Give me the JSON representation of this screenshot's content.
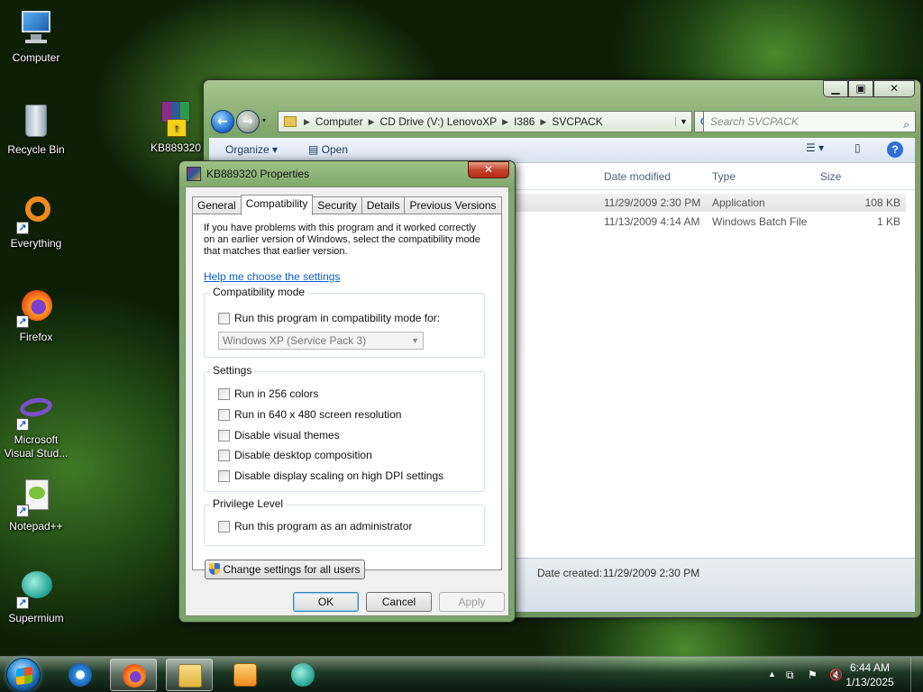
{
  "desktop": {
    "icons": [
      {
        "label": "Computer"
      },
      {
        "label": "Recycle Bin"
      },
      {
        "label": "Everything"
      },
      {
        "label": "Firefox"
      },
      {
        "label": "Microsoft Visual Stud..."
      },
      {
        "label": "Notepad++"
      },
      {
        "label": "Supermium"
      },
      {
        "label": "KB889320"
      }
    ]
  },
  "explorer": {
    "address": [
      "Computer",
      "CD Drive (V:) LenovoXP",
      "I386",
      "SVCPACK"
    ],
    "search_placeholder": "Search SVCPACK",
    "organize_label": "Organize",
    "open_label": "Open",
    "columns": [
      "Date modified",
      "Type",
      "Size"
    ],
    "files": [
      {
        "date": "11/29/2009 2:30 PM",
        "type": "Application",
        "size": "108 KB"
      },
      {
        "date": "11/13/2009 4:14 AM",
        "type": "Windows Batch File",
        "size": "1 KB"
      }
    ],
    "details_label": "Date created:",
    "details_value": "11/29/2009 2:30 PM"
  },
  "dialog": {
    "title": "KB889320 Properties",
    "tabs": [
      "General",
      "Compatibility",
      "Security",
      "Details",
      "Previous Versions"
    ],
    "intro": "If you have problems with this program and it worked correctly on an earlier version of Windows, select the compatibility mode that matches that earlier version.",
    "help_link": "Help me choose the settings",
    "compat_group": "Compatibility mode",
    "compat_check": "Run this program in compatibility mode for:",
    "compat_select": "Windows XP (Service Pack 3)",
    "settings_group": "Settings",
    "settings": [
      "Run in 256 colors",
      "Run in 640 x 480 screen resolution",
      "Disable visual themes",
      "Disable desktop composition",
      "Disable display scaling on high DPI settings"
    ],
    "privilege_group": "Privilege Level",
    "privilege_check": "Run this program as an administrator",
    "change_all": "Change settings for all users",
    "ok": "OK",
    "cancel": "Cancel",
    "apply": "Apply"
  },
  "taskbar": {
    "time": "6:44 AM",
    "date": "1/13/2025"
  }
}
